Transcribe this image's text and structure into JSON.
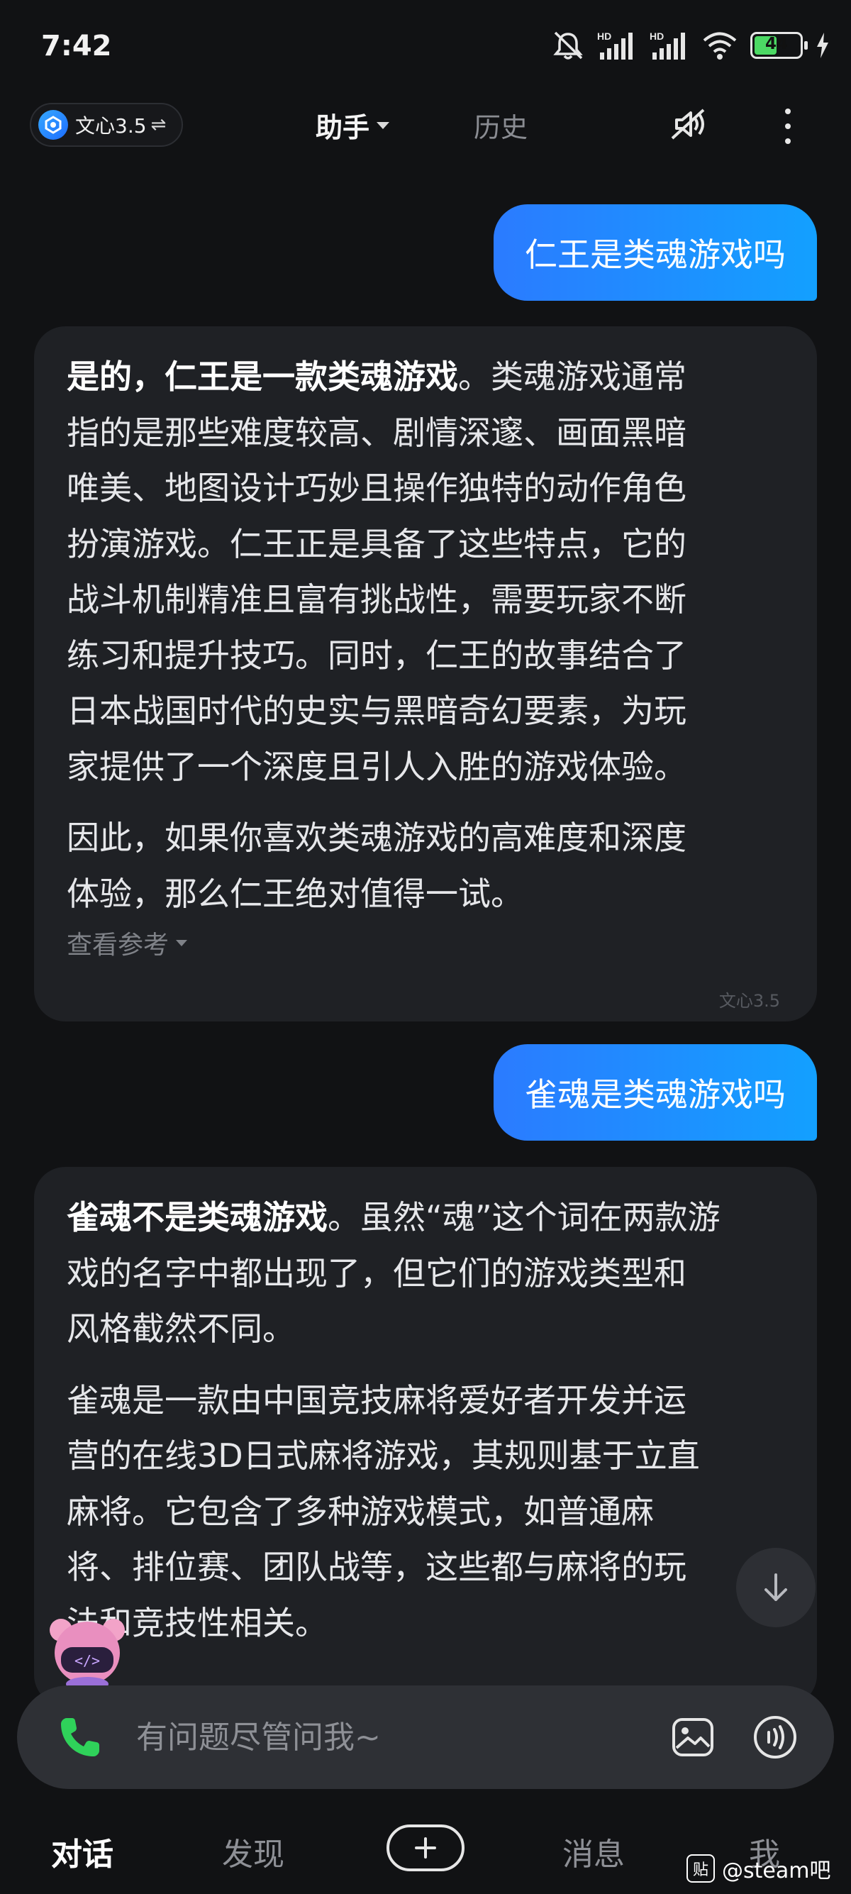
{
  "status_bar": {
    "time": "7:42",
    "hd1": "HD",
    "hd2": "HD",
    "battery_level": "44"
  },
  "header": {
    "model_name": "文心3.5",
    "model_swap_glyph": "⇌",
    "tab_assistant": "助手",
    "tab_history": "历史"
  },
  "chat": {
    "q1": "仁王是类魂游戏吗",
    "a1": {
      "bold": "是的，仁王是一款类魂游戏",
      "lines": [
        "。类魂游戏通常",
        "指的是那些难度较高、剧情深邃、画面黑暗",
        "唯美、地图设计巧妙且操作独特的动作角色",
        "扮演游戏。仁王正是具备了这些特点，它的",
        "战斗机制精准且富有挑战性，需要玩家不断",
        "练习和提升技巧。同时，仁王的故事结合了",
        "日本战国时代的史实与黑暗奇幻要素，为玩",
        "家提供了一个深度且引人入胜的游戏体验。"
      ],
      "p2_lines": [
        "因此，如果你喜欢类魂游戏的高难度和深度",
        "体验，那么仁王绝对值得一试。"
      ],
      "ref_label": "查看参考",
      "model_tag": "文心3.5"
    },
    "q2": "雀魂是类魂游戏吗",
    "a2": {
      "bold": "雀魂不是类魂游戏",
      "lines": [
        "。虽然“魂”这个词在两款游",
        "戏的名字中都出现了，但它们的游戏类型和",
        "风格截然不同。"
      ],
      "p2_lines": [
        "雀魂是一款由中国竞技麻将爱好者开发并运",
        "营的在线3D日式麻将游戏，其规则基于立直",
        "麻将。它包含了多种游戏模式，如普通麻",
        "将、排位赛、团队战等，这些都与麻将的玩",
        "法和竞技性相关。"
      ]
    }
  },
  "input": {
    "placeholder": "有问题尽管问我~"
  },
  "nav": {
    "chat": "对话",
    "discover": "发现",
    "messages": "消息",
    "me": "我"
  },
  "watermark": {
    "logo": "贴",
    "text": "@steam吧"
  }
}
